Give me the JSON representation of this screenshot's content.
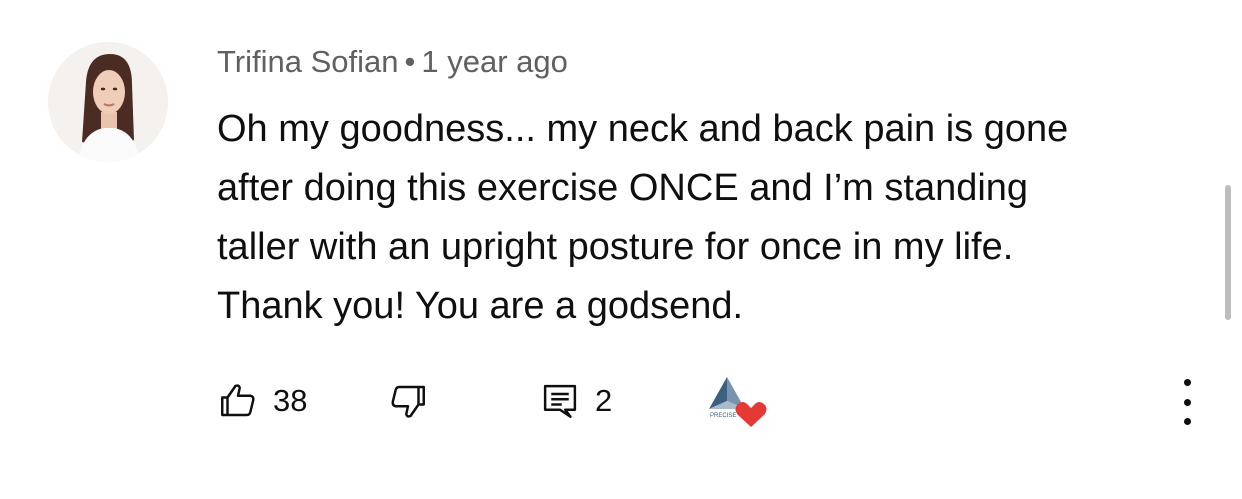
{
  "comment": {
    "author": "Trifina Sofian",
    "separator": "•",
    "timestamp": "1 year ago",
    "text_lines": [
      "Oh my goodness... my neck and back pain is gone",
      "after doing this exercise ONCE and I’m standing",
      "taller with an upright posture for once in my life.",
      "Thank you! You are a godsend."
    ],
    "like_count": "38",
    "reply_count": "2",
    "creator_heart": true,
    "creator_logo_text": "PRECISE"
  },
  "icons": {
    "like": "thumbs-up-icon",
    "dislike": "thumbs-down-icon",
    "reply": "comment-reply-icon",
    "more": "more-vertical-icon",
    "heart": "heart-icon"
  },
  "colors": {
    "text": "#0f0f0f",
    "meta": "#606060",
    "heart": "#e53935",
    "logo": "#4a6a8a"
  }
}
